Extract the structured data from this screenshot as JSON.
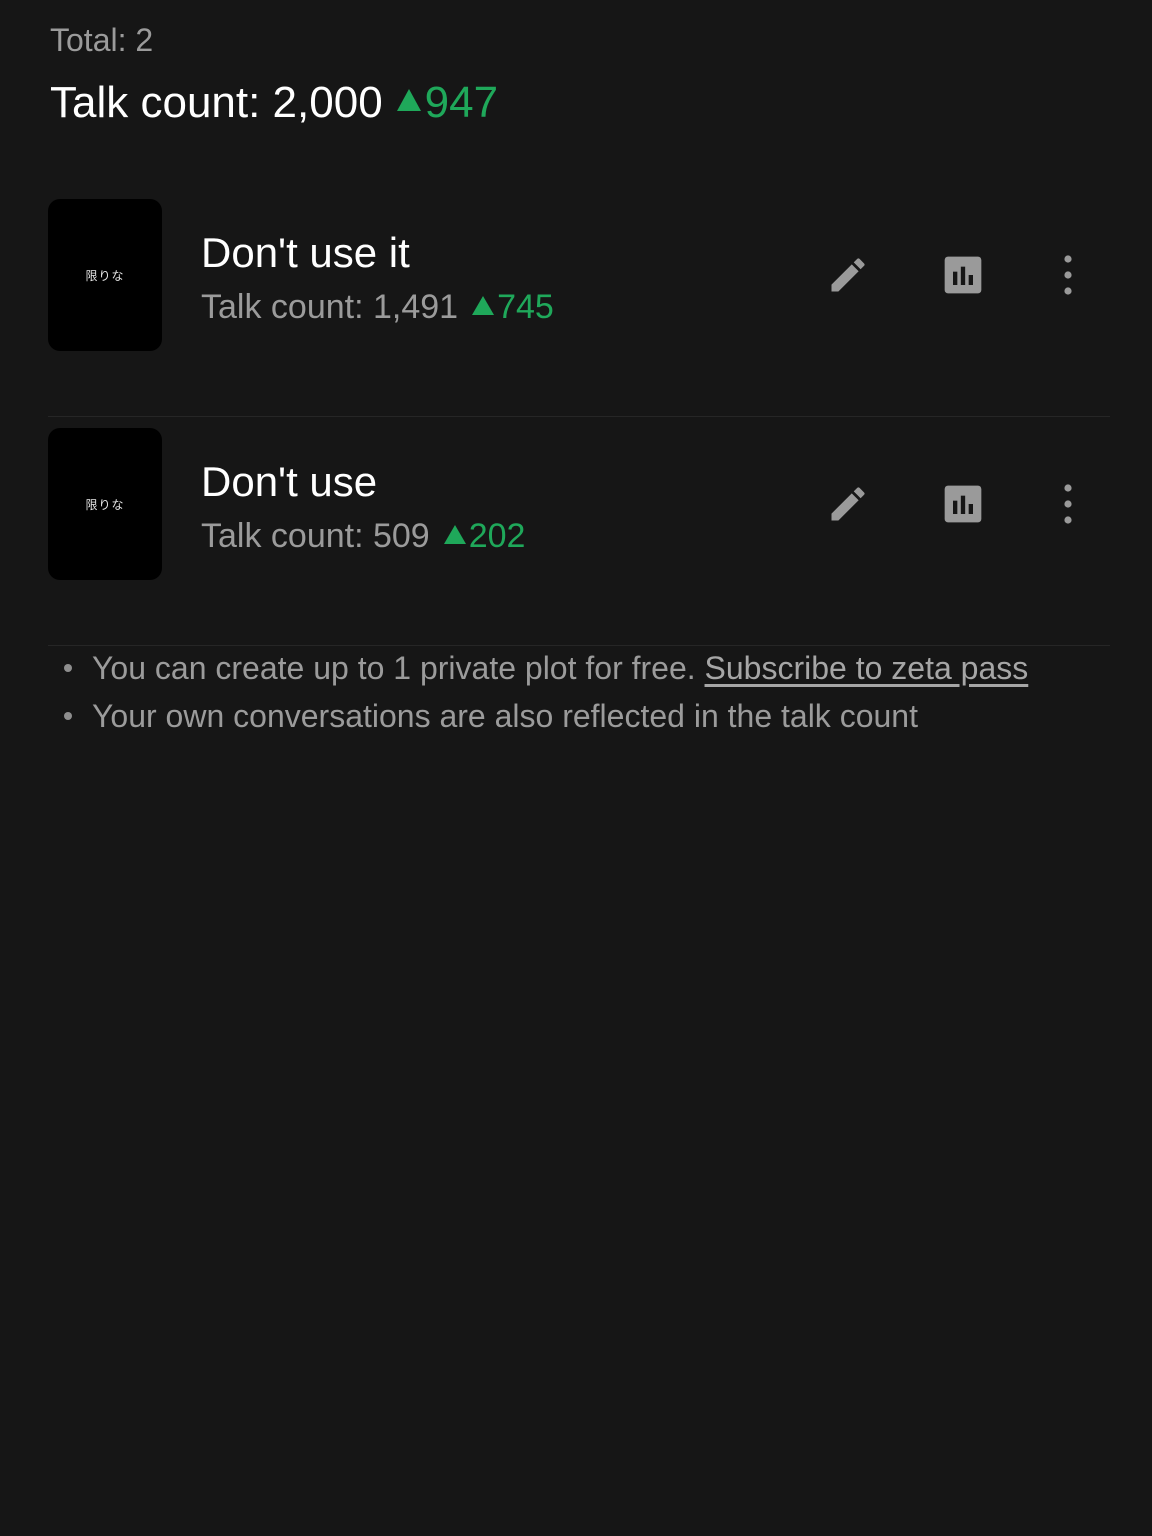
{
  "summary": {
    "total_label": "Total: 2",
    "talk_count_label": "Talk count: 2,000",
    "talk_count_delta": "947"
  },
  "plots": [
    {
      "thumbnail_text": "限りな",
      "title": "Don't use it",
      "talk_count_label": "Talk count: 1,491",
      "delta": "745"
    },
    {
      "thumbnail_text": "限りな",
      "title": "Don't use",
      "talk_count_label": "Talk count: 509",
      "delta": "202"
    }
  ],
  "notes": {
    "first_text": "You can create up to 1 private plot for free.",
    "first_link": "Subscribe to zeta pass",
    "second_text": "Your own conversations are also reflected in the talk count"
  },
  "icons": {
    "edit": "pencil-icon",
    "stats": "bar-chart-icon",
    "more": "more-vertical-icon",
    "delta": "triangle-up-icon"
  },
  "colors": {
    "background": "#161616",
    "positive_delta": "#1fa85a",
    "muted_text": "#9b9b9b",
    "icon": "#9a9a9a"
  }
}
